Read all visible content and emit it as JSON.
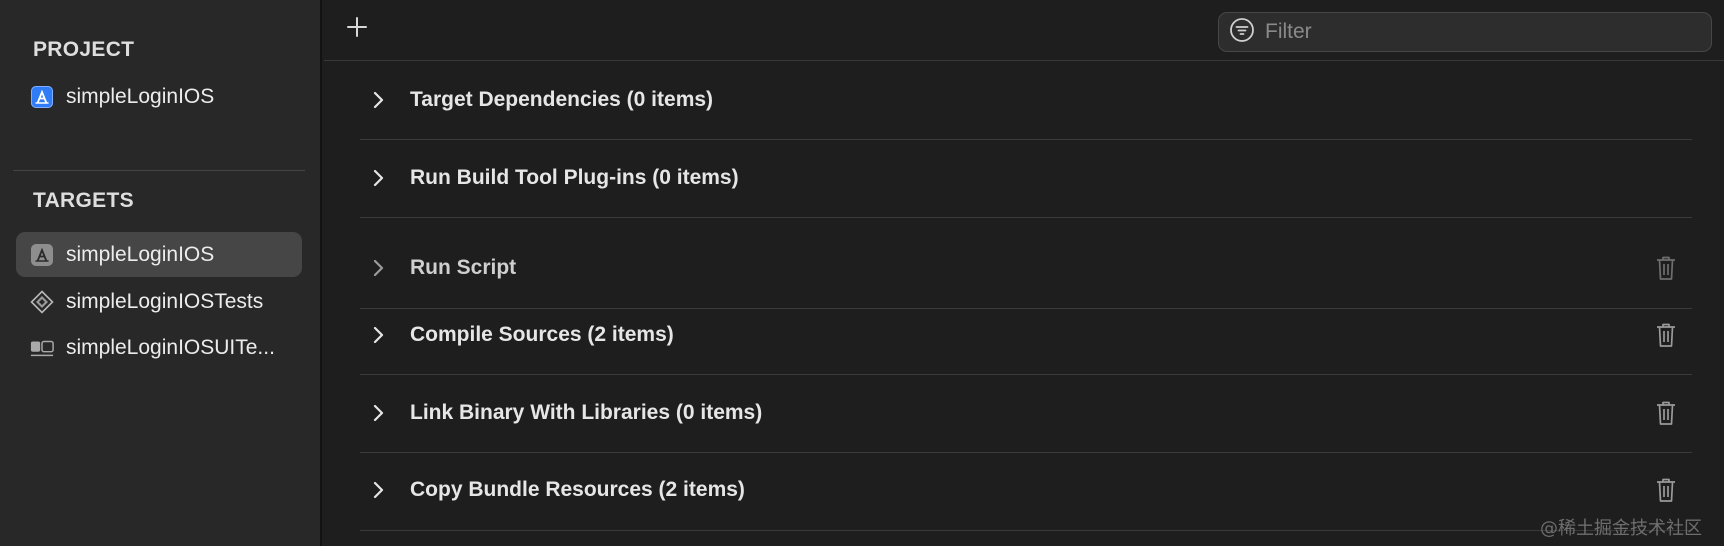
{
  "sidebar": {
    "project_header": "PROJECT",
    "project_item": {
      "label": "simpleLoginIOS",
      "icon": "xcode-project-icon"
    },
    "targets_header": "TARGETS",
    "targets": [
      {
        "label": "simpleLoginIOS",
        "icon": "app-target-icon",
        "selected": true
      },
      {
        "label": "simpleLoginIOSTests",
        "icon": "unit-test-target-icon",
        "selected": false
      },
      {
        "label": "simpleLoginIOSUITe...",
        "icon": "ui-test-target-icon",
        "selected": false
      }
    ]
  },
  "toolbar": {
    "add_icon": "plus-icon",
    "filter": {
      "placeholder": "Filter",
      "value": "",
      "icon": "filter-icon"
    }
  },
  "build_phases": [
    {
      "title": "Target Dependencies (0 items)",
      "deletable": false
    },
    {
      "title": "Run Build Tool Plug-ins (0 items)",
      "deletable": false
    },
    {
      "title": "Run Script",
      "deletable": true
    },
    {
      "title": "Compile Sources (2 items)",
      "deletable": true
    },
    {
      "title": "Link Binary With Libraries (0 items)",
      "deletable": true
    },
    {
      "title": "Copy Bundle Resources (2 items)",
      "deletable": true
    }
  ],
  "watermark": "@稀土掘金技术社区",
  "colors": {
    "background": "#1e1e1e",
    "sidebar": "#282828",
    "selection": "#464646",
    "project_icon_blue": "#2f7cf6"
  }
}
